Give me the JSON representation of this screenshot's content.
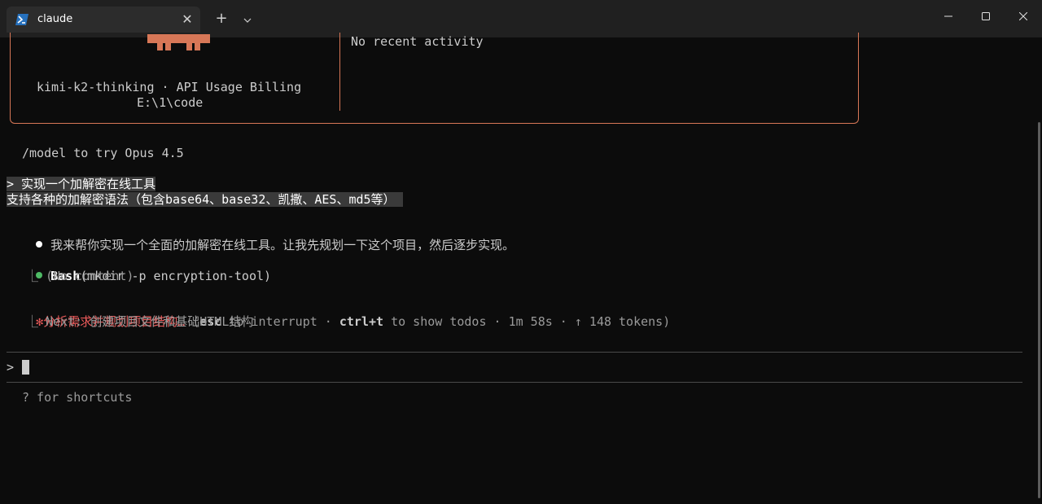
{
  "window": {
    "tab_title": "claude",
    "new_tab_glyph": "+",
    "dropdown_glyph": "⌄",
    "close_glyph": "✕"
  },
  "welcome": {
    "model_line": "kimi-k2-thinking · API Usage Billing",
    "cwd": "E:\\1\\code",
    "recent_activity": "No recent activity"
  },
  "hint": "/model to try Opus 4.5",
  "user_prompt": {
    "line1": "> 实现一个加解密在线工具",
    "line2": "支持各种的加解密语法（包含base64、base32、凯撒、AES、md5等） "
  },
  "assistant_message": "我来帮你实现一个全面的加解密在线工具。让我先规划一下这个项目，然后逐步实现。",
  "tool_call": {
    "name": "Bash",
    "args": "(mkdir -p encryption-tool)",
    "result_prefix": "⎿",
    "result": " (No content)"
  },
  "status": {
    "spinner": "✻",
    "task": "分析需求并规划项目结构…",
    "open_paren": " (",
    "esc_key": "esc",
    "esc_text": " to interrupt · ",
    "todos_key": "ctrl+t",
    "todos_text": " to show todos · 1m 58s · ↑ 148 tokens)",
    "next_prefix": "⎿",
    "next": " Next: 创建项目文件和基础HTML结构"
  },
  "input": {
    "prompt": ">",
    "value": ""
  },
  "footer": "? for shortcuts",
  "colors": {
    "accent": "#d77757",
    "success": "#4eba65",
    "status": "#eb5a5a",
    "text": "#cccccc",
    "dim": "#9a9a9a"
  }
}
